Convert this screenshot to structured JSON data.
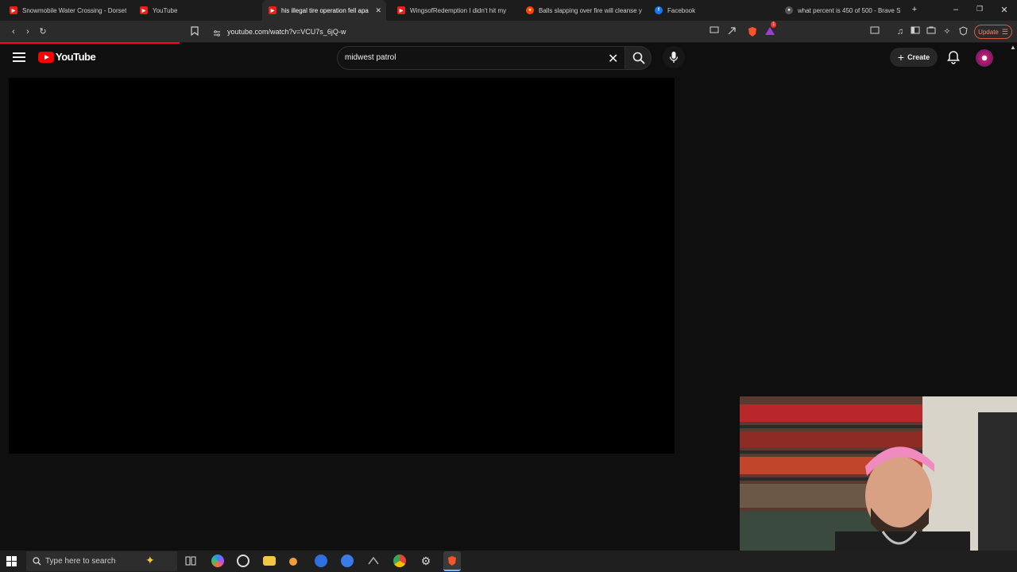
{
  "browser": {
    "tabs": [
      {
        "title": "Snowmobile Water Crossing - Dorset",
        "favicon": "youtube-icon",
        "active": false
      },
      {
        "title": "YouTube",
        "favicon": "youtube-icon",
        "active": false
      },
      {
        "title": "his illegal tire operation fell apa",
        "favicon": "youtube-icon",
        "active": true
      },
      {
        "title": "WingsofRedemption I didn't hit my",
        "favicon": "youtube-icon",
        "active": false
      },
      {
        "title": "Balls slapping over fire will cleanse y",
        "favicon": "reddit-icon",
        "active": false
      },
      {
        "title": "Facebook",
        "favicon": "facebook-icon",
        "active": false
      },
      {
        "title": "what percent is 450 of 500 - Brave S",
        "favicon": "brave-search-icon",
        "active": false
      }
    ],
    "new_tab_label": "+",
    "url": "youtube.com/watch?v=VCU7s_6jQ-w",
    "update_label": "Update",
    "brave_badge": "1"
  },
  "youtube": {
    "logo_text": "YouTube",
    "search_value": "midwest patrol",
    "create_label": "Create"
  },
  "taskbar": {
    "search_placeholder": "Type here to search"
  },
  "colors": {
    "accent_red": "#ff0000",
    "background": "#0f0f0f",
    "brave_orange": "#fb542b"
  }
}
